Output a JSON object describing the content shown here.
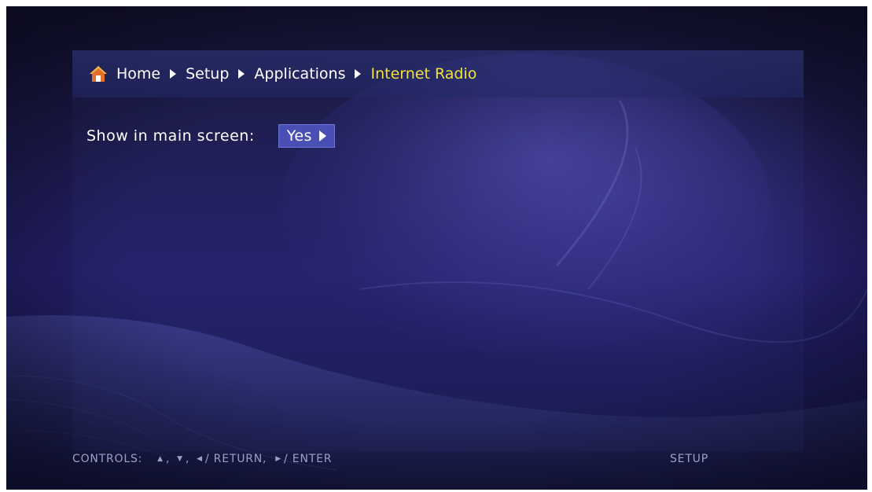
{
  "breadcrumb": {
    "items": [
      {
        "label": "Home",
        "icon": "home-icon"
      },
      {
        "label": "Setup"
      },
      {
        "label": "Applications"
      },
      {
        "label": "Internet Radio"
      }
    ]
  },
  "setting": {
    "label": "Show in main screen:",
    "value": "Yes"
  },
  "footer": {
    "controls_label": "CONTROLS:",
    "up_glyph": "▲",
    "down_glyph": "▼",
    "left_glyph": "◀",
    "right_glyph": "▶",
    "comma": ",",
    "return_text": "/ RETURN,",
    "enter_text": "/ ENTER",
    "section": "SETUP"
  },
  "colors": {
    "accent_current": "#f2e33c",
    "selected_value_bg": "#4a4fb6",
    "background": "#1f1c5a"
  }
}
